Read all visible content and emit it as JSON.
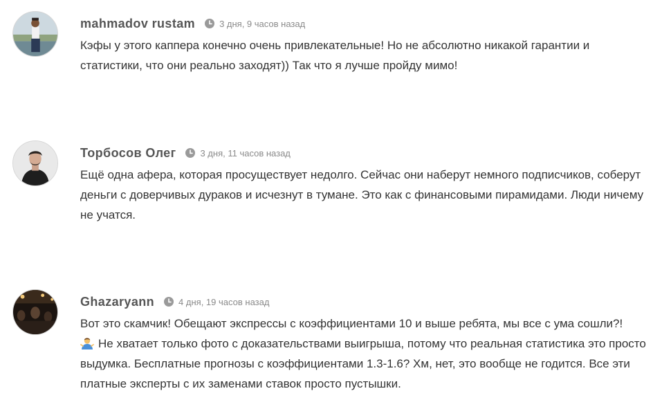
{
  "comments": [
    {
      "author": "mahmadov rustam",
      "time": "3 дня, 9 часов назад",
      "text": "Кэфы у этого каппера конечно очень привлекательные! Но не абсолютно никакой гарантии и статистики, что они реально заходят)) Так что я лучше пройду мимо!",
      "avatar_icon": "user-photo-outdoor"
    },
    {
      "author": "Торбосов Олег",
      "time": "3 дня, 11 часов назад",
      "text": "Ещё одна афера, которая просуществует недолго. Сейчас они наберут немного подписчиков, соберут деньги с доверчивых дураков и исчезнут в тумане. Это как с финансовыми пирамидами. Люди ничему не учатся.",
      "avatar_icon": "user-photo-portrait"
    },
    {
      "author": "Ghazaryann",
      "time": "4 дня, 19 часов назад",
      "text_line1": "Вот это скамчик! Обещают экспрессы с коэффициентами 10 и выше ребята, мы все с ума сошли?!",
      "emoji": "person-shrugging-emoji",
      "text_rest": "Не хватает только фото с доказательствами выигрыша, потому что реальная статистика это просто выдумка. Бесплатные прогнозы с коэффициентами 1.3-1.6? Хм, нет, это вообще не годится. Все эти платные эксперты с их заменами ставок просто пустышки.",
      "avatar_icon": "user-photo-crowd"
    }
  ],
  "colors": {
    "author": "#555555",
    "time": "#8a8a8a",
    "text": "#333333",
    "clock": "#9a9a9a"
  }
}
